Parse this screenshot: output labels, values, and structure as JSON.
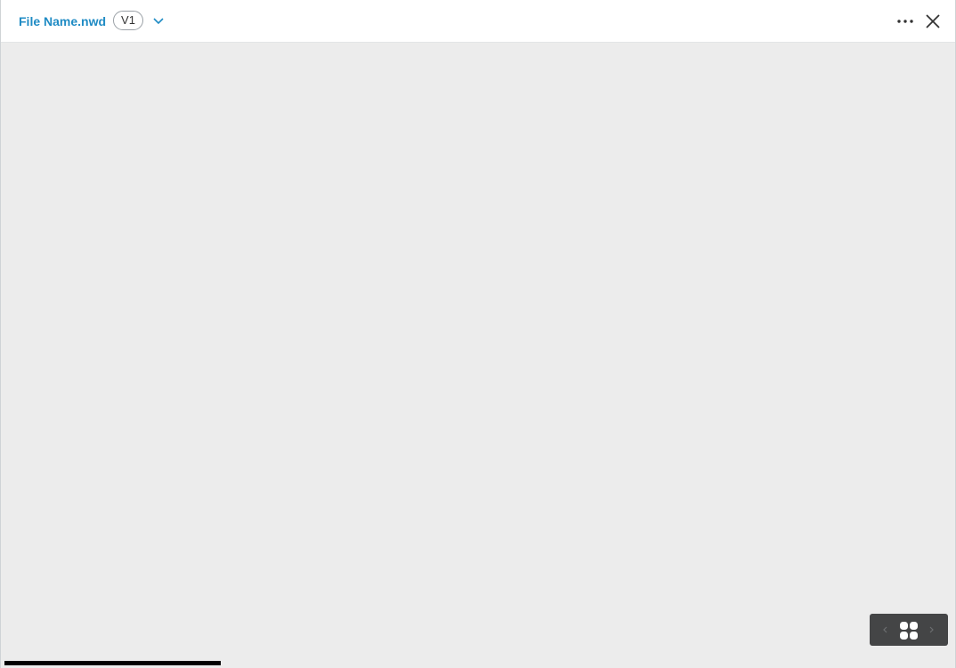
{
  "header": {
    "file_name": "File Name.nwd",
    "version_label": "V1",
    "version_dropdown_icon": "chevron-down-icon",
    "more_icon": "more-horizontal-icon",
    "close_icon": "close-icon",
    "accent_color": "#1f8bc4"
  },
  "viewer": {
    "background_color": "#ececec",
    "nav": {
      "prev_icon": "chevron-left-icon",
      "grid_icon": "grid-icon",
      "next_icon": "chevron-right-icon",
      "prev_enabled": false,
      "next_enabled": false
    },
    "progress_color": "#000000"
  }
}
